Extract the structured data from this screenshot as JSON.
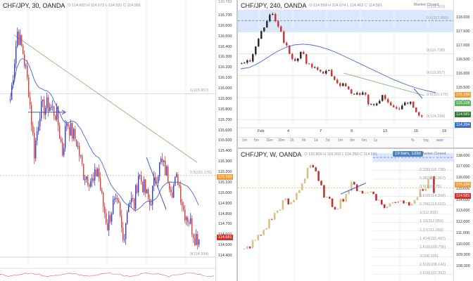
{
  "panel_left": {
    "symbol": "CHF/JPY, 30, OANDA",
    "ohlc": "O 114.603 H 114.672 L 114.531 C 114.581",
    "price_ticks": [
      "116.700",
      "116.600",
      "116.500",
      "116.400",
      "116.300",
      "116.200",
      "116.100",
      "116.000",
      "115.900",
      "115.800",
      "115.700",
      "115.600",
      "115.500",
      "115.400",
      "115.300",
      "115.200",
      "115.100",
      "115.000",
      "114.900",
      "114.800",
      "114.700",
      "114.600",
      "114.500",
      "114.400"
    ],
    "top_tick": "116.783",
    "fib_labels": [
      "1(115.957)",
      "0.5(115.175)",
      "0(114.394)"
    ],
    "orange_badge": "115.160",
    "red_badge": "114.581"
  },
  "panel_tr": {
    "symbol": "CHF/JPY, 240, OANDA",
    "ohlc": "O 114.559 H 114.674 L 114.462 C 114.581",
    "status": "Market Closed",
    "price_ticks": [
      "118.000",
      "117.500",
      "117.000",
      "116.500",
      "116.000",
      "115.500",
      "115.000"
    ],
    "fib_labels": [
      "1(118.303)",
      "0.6(117.909)",
      "0(116.738)",
      "0(115.957)",
      "0.5(115.175)",
      "0(114.394)"
    ],
    "time_labels": [
      "Feb",
      "4",
      "7",
      "9",
      "13",
      "15",
      "19"
    ],
    "timeframes": [
      "1m",
      "5m",
      "15m",
      "30m",
      "1h",
      "4h",
      "1d",
      "5d",
      "1m",
      "3m",
      "6m",
      "1y"
    ],
    "toolbar": [
      "%",
      "log",
      "auto"
    ],
    "green_badge": "115.108",
    "orange_badge": "115.160",
    "dark_badge": "114.581",
    "blue_badge": "114.394"
  },
  "panel_br": {
    "symbol": "CHF/JPY, W, OANDA",
    "ohlc": "O 115.809 H 116.002 L 114.350 C 114.581",
    "status": "Market Closed",
    "bars_badge": "19 bars, 133d",
    "price_ticks": [
      "118.000",
      "117.000",
      "116.000",
      "115.000",
      "114.000",
      "113.000",
      "112.000",
      "111.000",
      "110.000",
      "109.000",
      "108.000"
    ],
    "fib_labels": [
      "0.236(116.738)",
      "0.382(115.957)",
      "0.5(115.175)",
      "0.618(114.394)",
      "0.786(113.613)",
      "1(112.832)",
      "1.13(112.050)",
      "1.27(111.269)",
      "1.414(110.487)",
      "1.618(109.706)",
      "2(108.925)",
      "2.618(108.143)",
      "3.618(107.362)"
    ],
    "orange_badge": "115.160",
    "red_badge": "114.581"
  }
}
